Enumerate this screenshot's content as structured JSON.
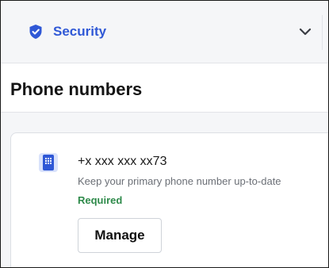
{
  "header": {
    "section_label": "Security",
    "icon": "shield-check-icon",
    "toggle_icon": "chevron-down-icon"
  },
  "page": {
    "title": "Phone numbers"
  },
  "phone_card": {
    "icon": "phone-keypad-icon",
    "number": "+x xxx xxx xx73",
    "description": "Keep your primary phone number up-to-date",
    "status": "Required",
    "action_label": "Manage"
  },
  "colors": {
    "accent": "#2f58d6",
    "status_green": "#2e8a4a",
    "background": "#f5f6f8"
  }
}
